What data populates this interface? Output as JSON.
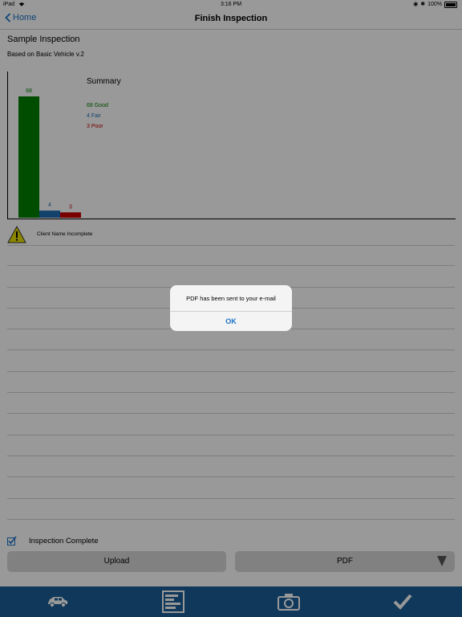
{
  "status_bar": {
    "device": "iPad",
    "time": "3:16 PM",
    "battery": "100%"
  },
  "nav": {
    "back_label": "Home",
    "title": "Finish Inspection"
  },
  "inspection": {
    "title": "Sample Inspection",
    "subtitle": "Based on Basic Vehicle v.2"
  },
  "chart_data": {
    "type": "bar",
    "title": "Summary",
    "categories": [
      "Good",
      "Fair",
      "Poor"
    ],
    "values": [
      68,
      4,
      3
    ],
    "value_labels": [
      "68",
      "4",
      "3"
    ],
    "legend": [
      "68 Good",
      "4 Fair",
      "3 Poor"
    ],
    "colors": [
      "#008000",
      "#1f6fb4",
      "#cc0000"
    ],
    "ylim": [
      0,
      68
    ],
    "legend_position": "top-left"
  },
  "warning": {
    "icon": "warning-triangle-icon",
    "text": "Client Name Incomplete"
  },
  "complete": {
    "label": "Inspection Complete",
    "checked": true
  },
  "buttons": {
    "upload_label": "Upload",
    "pdf_label": "PDF"
  },
  "tabs": [
    {
      "icon": "car-icon"
    },
    {
      "icon": "report-icon"
    },
    {
      "icon": "camera-icon"
    },
    {
      "icon": "checkmark-icon"
    }
  ],
  "alert": {
    "message": "PDF has been sent to your e-mail",
    "ok_label": "OK"
  },
  "colors": {
    "accent": "#1a73c8",
    "tabbar": "#1b5e97",
    "button": "#d8d8d8"
  }
}
